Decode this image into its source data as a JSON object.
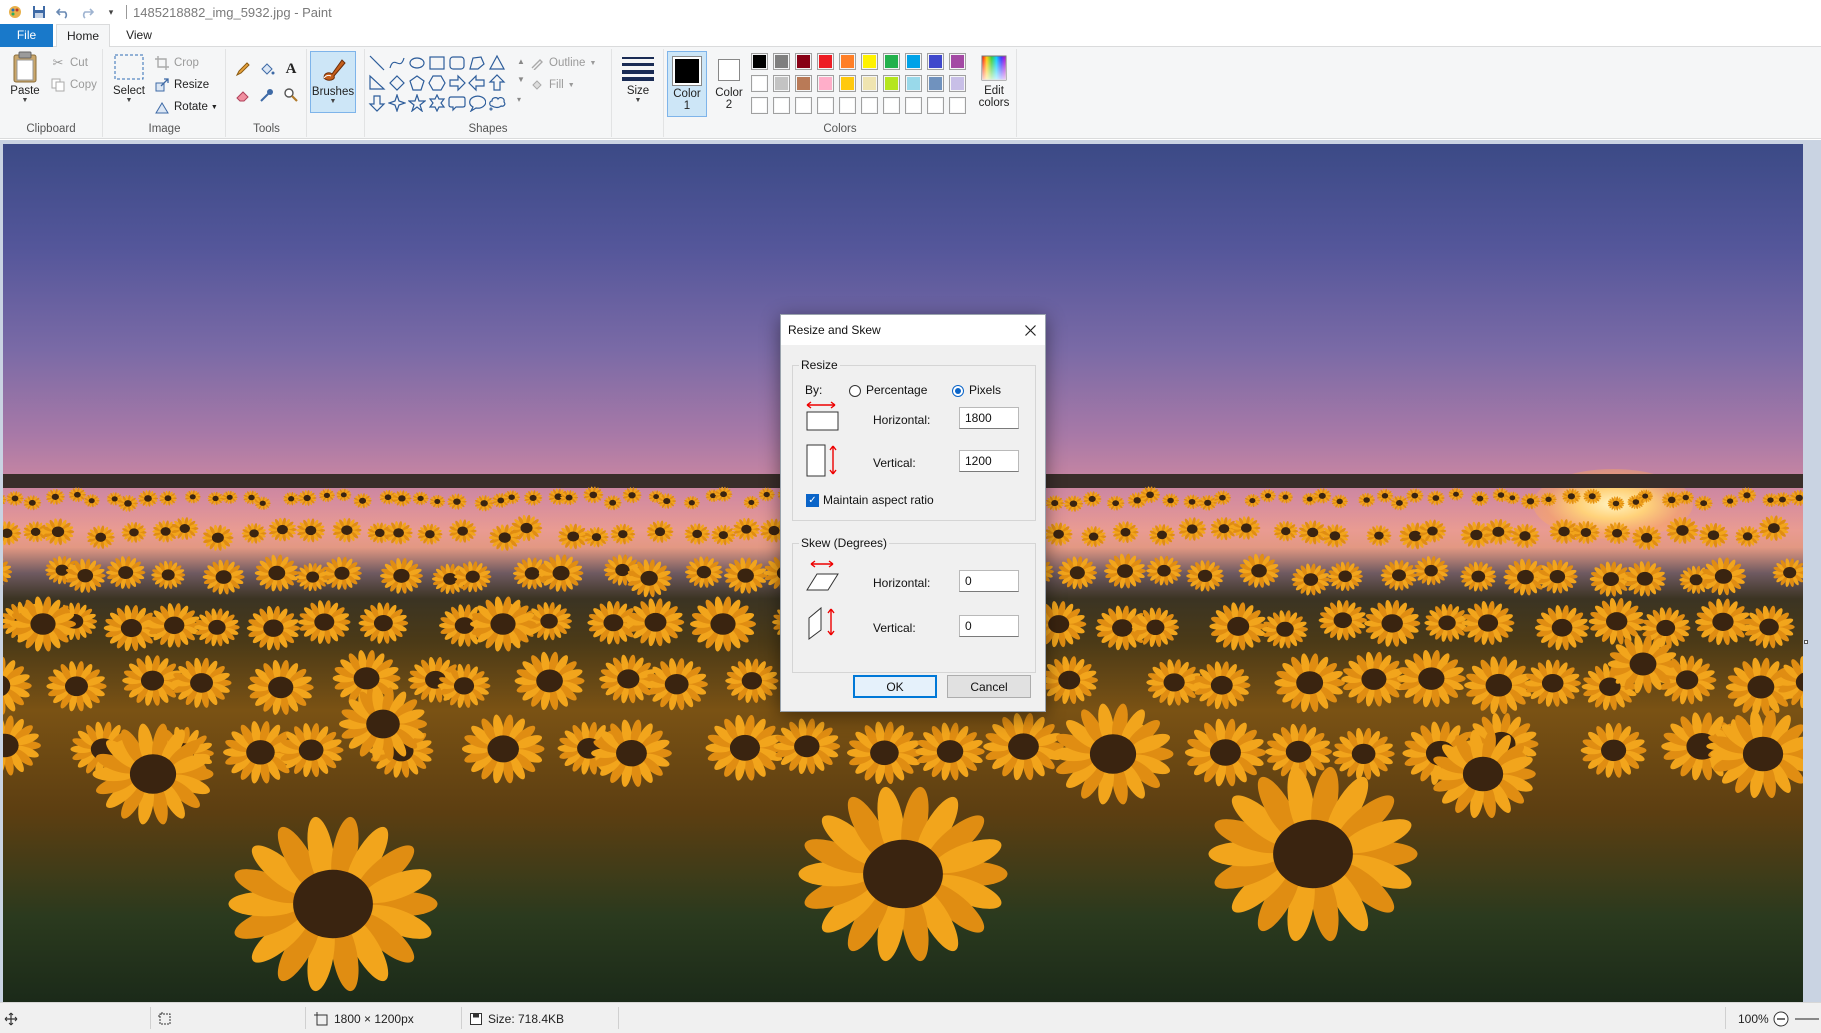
{
  "window": {
    "title": "1485218882_img_5932.jpg - Paint"
  },
  "tabs": {
    "file": "File",
    "home": "Home",
    "view": "View"
  },
  "ribbon": {
    "clipboard": {
      "label": "Clipboard",
      "paste": "Paste",
      "cut": "Cut",
      "copy": "Copy"
    },
    "image": {
      "label": "Image",
      "select": "Select",
      "crop": "Crop",
      "resize": "Resize",
      "rotate": "Rotate"
    },
    "tools": {
      "label": "Tools"
    },
    "brushes": {
      "label": "Brushes"
    },
    "shapes": {
      "label": "Shapes",
      "outline": "Outline",
      "fill": "Fill"
    },
    "size": {
      "label": "Size"
    },
    "colors": {
      "label": "Colors",
      "color1_line1": "Color",
      "color1_line2": "1",
      "color2_line1": "Color",
      "color2_line2": "2",
      "edit_line1": "Edit",
      "edit_line2": "colors",
      "color1": "#000000",
      "color2": "#ffffff",
      "palette_row1": [
        "#000000",
        "#7f7f7f",
        "#880015",
        "#ed1c24",
        "#ff7f27",
        "#fff200",
        "#22b14c",
        "#00a2e8",
        "#3f48cc",
        "#a349a4"
      ],
      "palette_row2": [
        "#ffffff",
        "#c3c3c3",
        "#b97a57",
        "#ffaec9",
        "#ffc90e",
        "#efe4b0",
        "#b5e61d",
        "#99d9ea",
        "#7092be",
        "#c8bfe7"
      ],
      "palette_row3": [
        "#ffffff",
        "#ffffff",
        "#ffffff",
        "#ffffff",
        "#ffffff",
        "#ffffff",
        "#ffffff",
        "#ffffff",
        "#ffffff",
        "#ffffff"
      ]
    }
  },
  "status": {
    "dimensions": "1800 × 1200px",
    "size": "Size: 718.4KB",
    "zoom": "100%"
  },
  "dialog": {
    "title": "Resize and Skew",
    "resize": {
      "legend": "Resize",
      "by_label": "By:",
      "percentage": "Percentage",
      "pixels": "Pixels",
      "selected": "Pixels",
      "horizontal_label": "Horizontal:",
      "horizontal_value": "1800",
      "vertical_label": "Vertical:",
      "vertical_value": "1200",
      "maintain_aspect": "Maintain aspect ratio",
      "maintain_aspect_checked": true
    },
    "skew": {
      "legend": "Skew (Degrees)",
      "horizontal_label": "Horizontal:",
      "horizontal_value": "0",
      "vertical_label": "Vertical:",
      "vertical_value": "0"
    },
    "ok": "OK",
    "cancel": "Cancel"
  }
}
